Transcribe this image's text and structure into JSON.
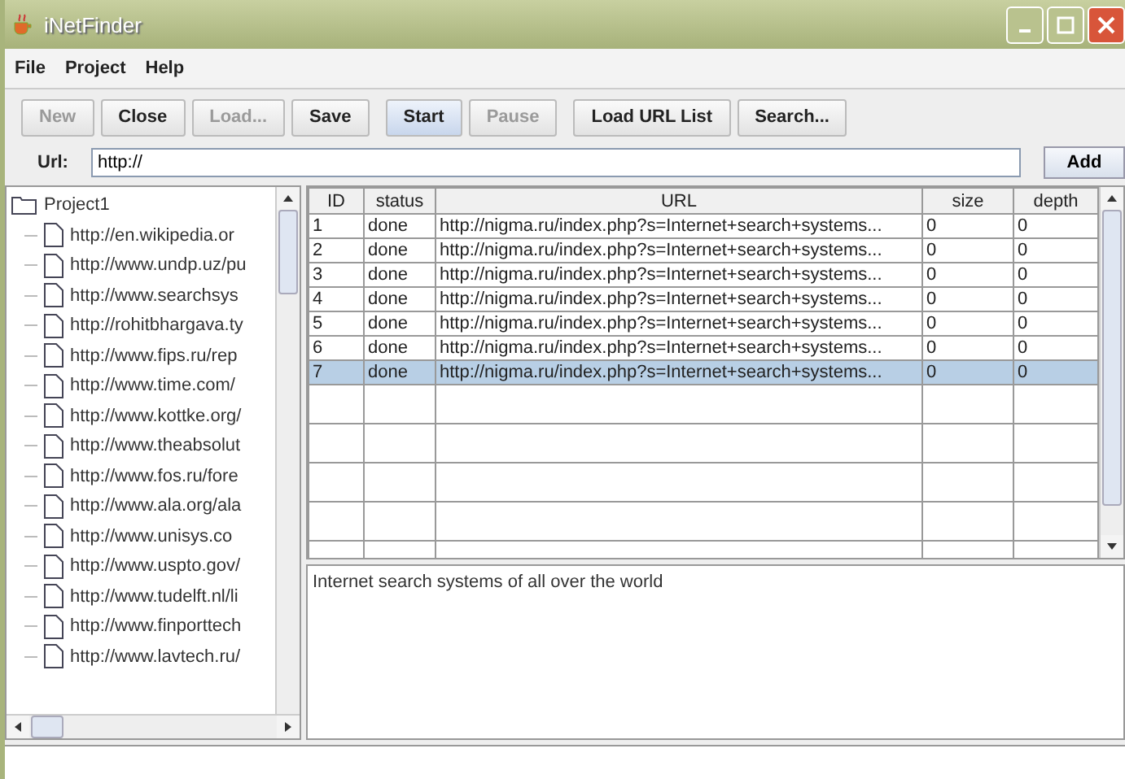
{
  "window": {
    "title": "iNetFinder"
  },
  "menu": [
    "File",
    "Project",
    "Help"
  ],
  "toolbar": [
    {
      "label": "New",
      "disabled": true,
      "highlighted": false
    },
    {
      "label": "Close",
      "disabled": false,
      "highlighted": false
    },
    {
      "label": "Load...",
      "disabled": true,
      "highlighted": false
    },
    {
      "label": "Save",
      "disabled": false,
      "highlighted": false
    },
    {
      "label": "Start",
      "disabled": false,
      "highlighted": true
    },
    {
      "label": "Pause",
      "disabled": true,
      "highlighted": false
    },
    {
      "label": "Load URL List",
      "disabled": false,
      "highlighted": false
    },
    {
      "label": "Search...",
      "disabled": false,
      "highlighted": false
    }
  ],
  "url_bar": {
    "label": "Url:",
    "value": "http://",
    "button": "Add"
  },
  "tree": {
    "label": "Project1",
    "children": [
      {
        "label": "http://en.wikipedia.or"
      },
      {
        "label": "http://www.undp.uz/pu"
      },
      {
        "label": "http://www.searchsys"
      },
      {
        "label": "http://rohitbhargava.ty"
      },
      {
        "label": "http://www.fips.ru/rep"
      },
      {
        "label": "http://www.time.com/"
      },
      {
        "label": "http://www.kottke.org/"
      },
      {
        "label": "http://www.theabsolut"
      },
      {
        "label": "http://www.fos.ru/fore"
      },
      {
        "label": "http://www.ala.org/ala"
      },
      {
        "label": "http://www.unisys.co"
      },
      {
        "label": "http://www.uspto.gov/"
      },
      {
        "label": "http://www.tudelft.nl/li"
      },
      {
        "label": "http://www.finporttech"
      },
      {
        "label": "http://www.lavtech.ru/"
      }
    ]
  },
  "table": {
    "columns": [
      "ID",
      "status",
      "URL",
      "size",
      "depth"
    ],
    "rows": [
      {
        "cells": [
          "1",
          "done",
          "http://nigma.ru/index.php?s=Internet+search+systems...",
          "0",
          "0"
        ],
        "selected": false
      },
      {
        "cells": [
          "2",
          "done",
          "http://nigma.ru/index.php?s=Internet+search+systems...",
          "0",
          "0"
        ],
        "selected": false
      },
      {
        "cells": [
          "3",
          "done",
          "http://nigma.ru/index.php?s=Internet+search+systems...",
          "0",
          "0"
        ],
        "selected": false
      },
      {
        "cells": [
          "4",
          "done",
          "http://nigma.ru/index.php?s=Internet+search+systems...",
          "0",
          "0"
        ],
        "selected": false
      },
      {
        "cells": [
          "5",
          "done",
          "http://nigma.ru/index.php?s=Internet+search+systems...",
          "0",
          "0"
        ],
        "selected": false
      },
      {
        "cells": [
          "6",
          "done",
          "http://nigma.ru/index.php?s=Internet+search+systems...",
          "0",
          "0"
        ],
        "selected": false
      },
      {
        "cells": [
          "7",
          "done",
          "http://nigma.ru/index.php?s=Internet+search+systems...",
          "0",
          "0"
        ],
        "selected": true
      }
    ]
  },
  "description": "Internet search systems of all over the world"
}
